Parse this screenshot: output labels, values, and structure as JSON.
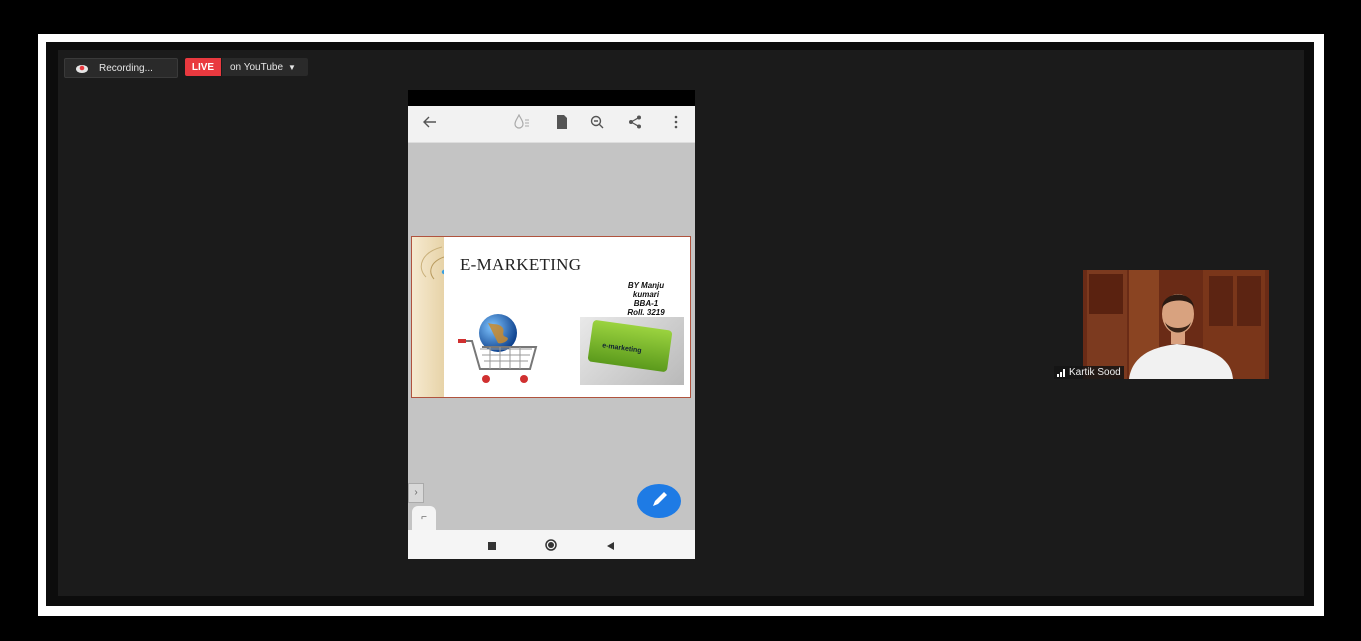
{
  "recording": {
    "label": "Recording..."
  },
  "live": {
    "badge": "LIVE",
    "destination": "on YouTube"
  },
  "shared_screen": {
    "toolbar_icons": [
      "back-arrow-icon",
      "ink-drop-icon",
      "document-icon",
      "zoom-out-icon",
      "share-icon",
      "more-vertical-icon"
    ],
    "slide": {
      "title": "E-MARKETING",
      "author_lines": [
        "BY Manju",
        "kumari",
        "BBA-1",
        "Roll. 3219"
      ],
      "key_label": "e-marketing"
    },
    "nav_icons": [
      "square-icon",
      "circle-icon",
      "triangle-back-icon"
    ]
  },
  "participant": {
    "name": "Kartik Sood"
  },
  "colors": {
    "live_red": "#e9393f",
    "fab_blue": "#1e7be5",
    "slide_border": "#b0533e",
    "meeting_bg": "#1b1b1b"
  }
}
